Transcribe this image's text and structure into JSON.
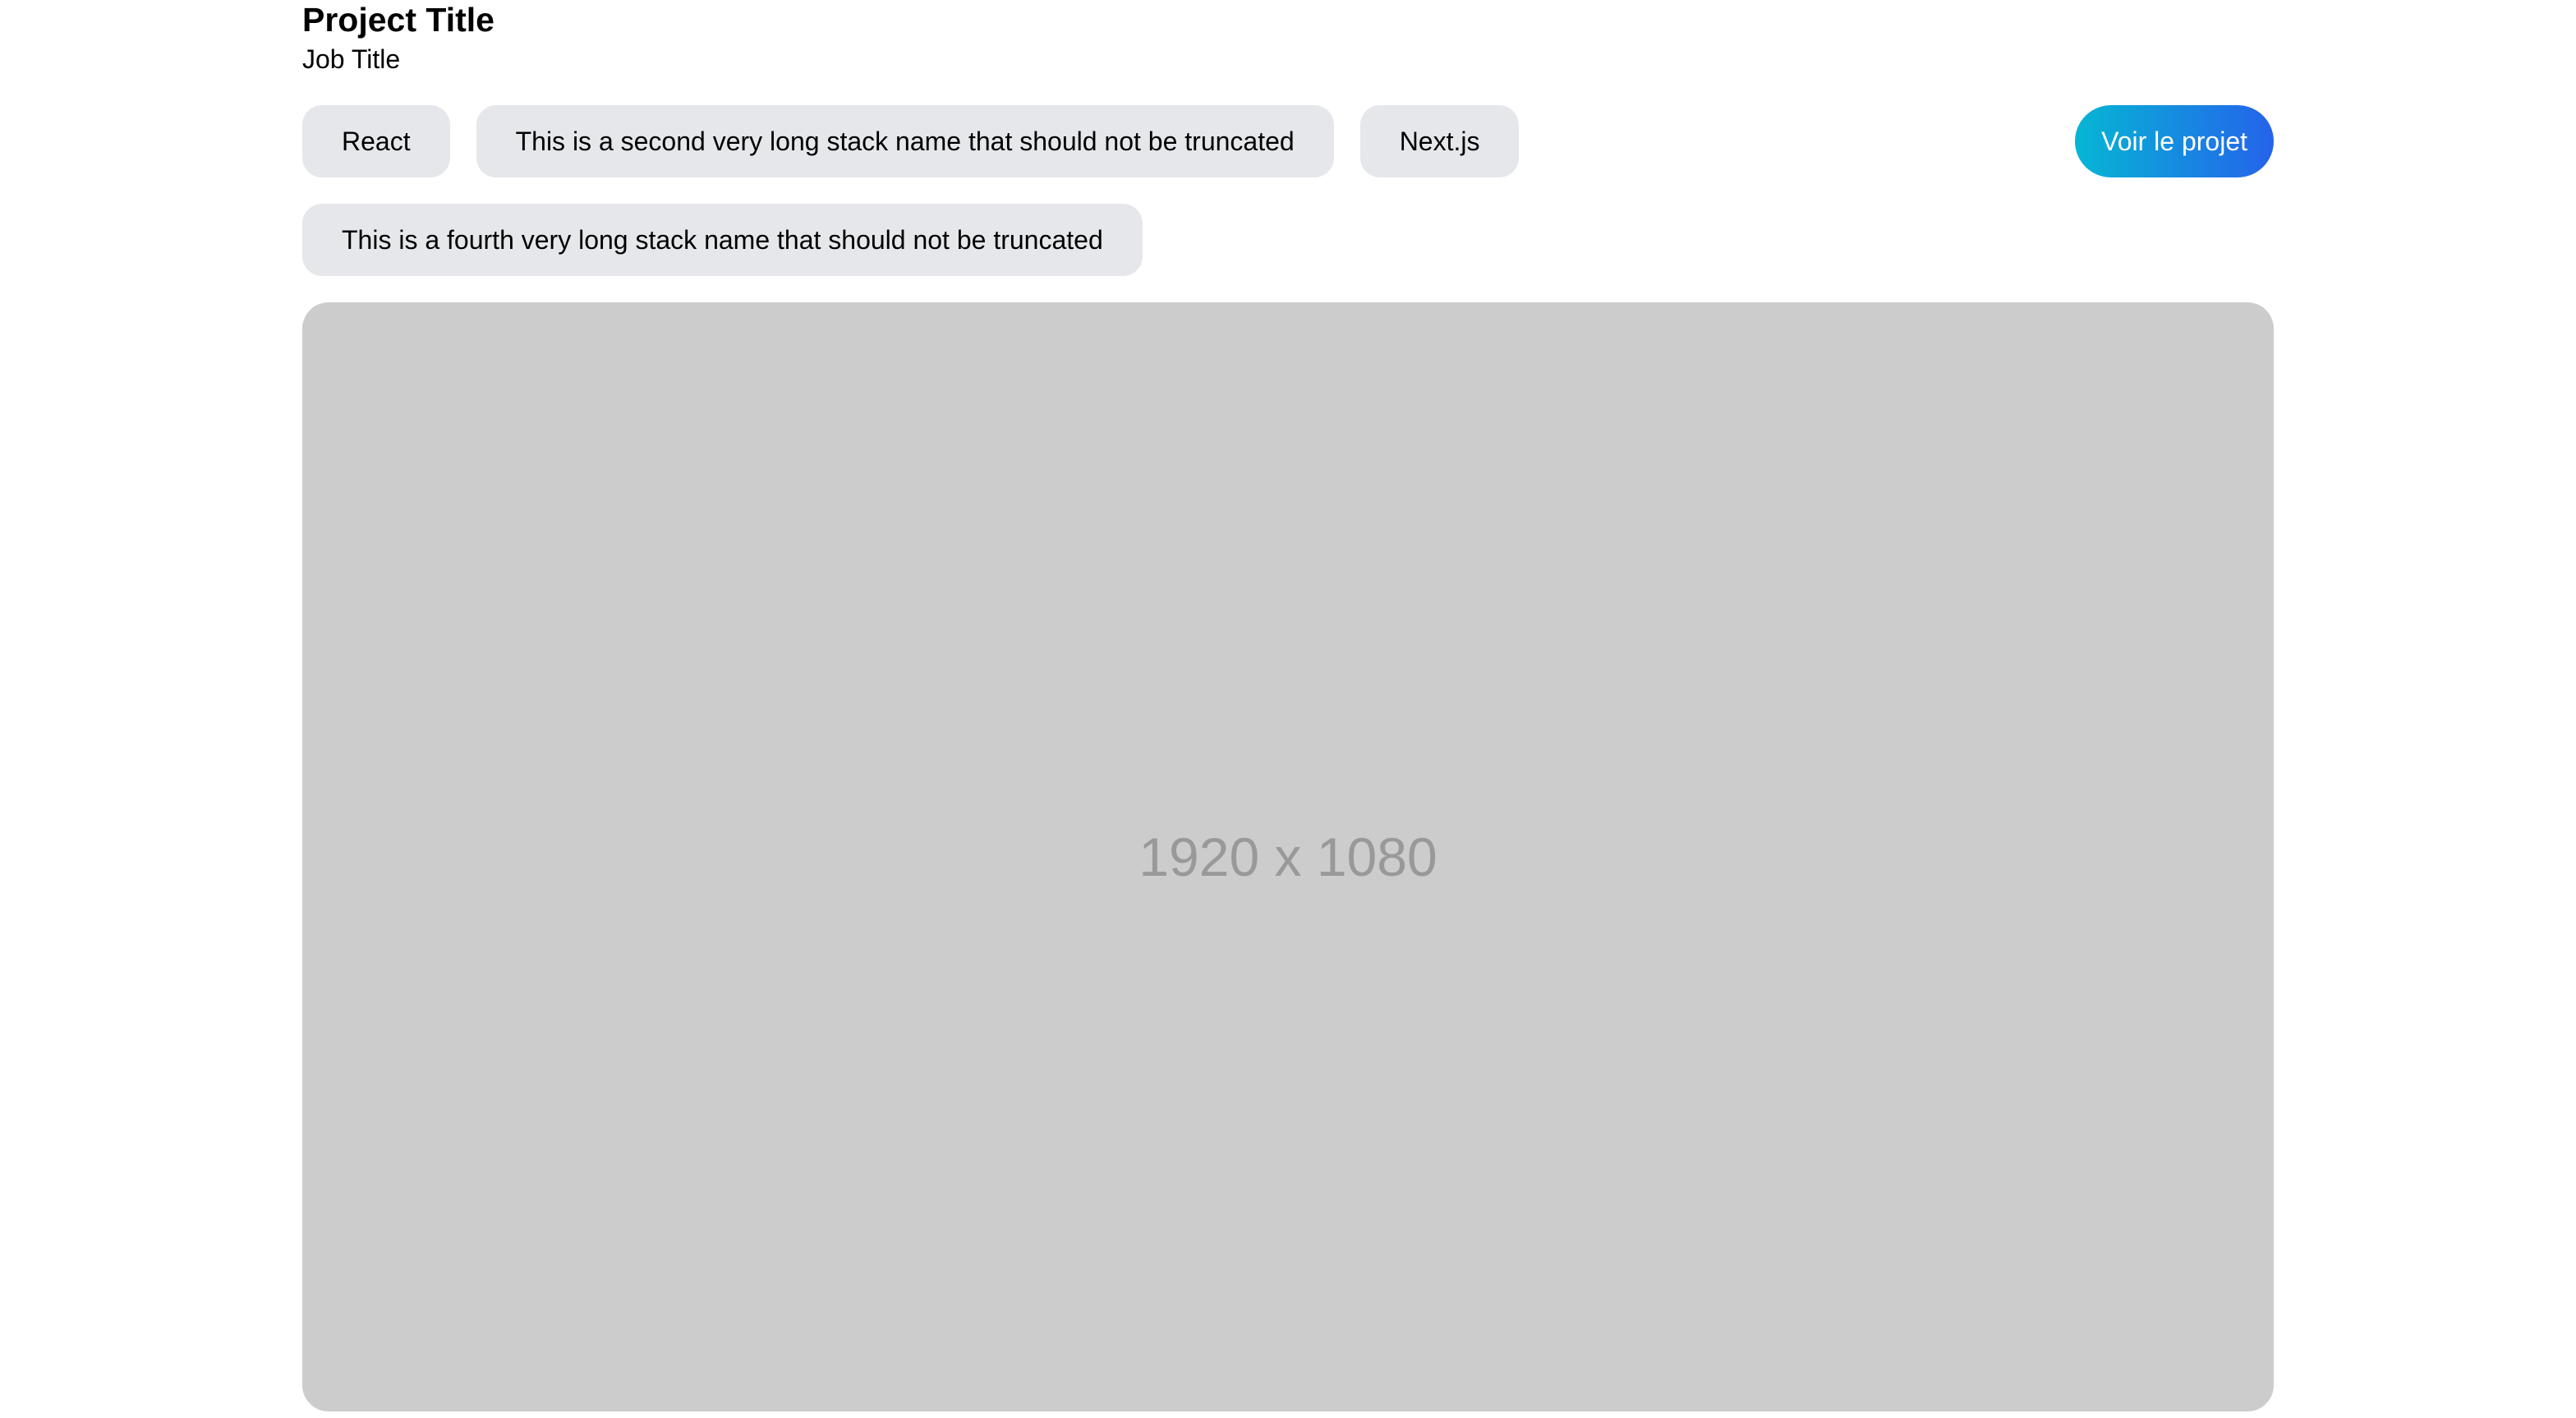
{
  "project": {
    "title": "Project Title",
    "job_title": "Job Title",
    "stacks": [
      "React",
      "This is a second very long stack name that should not be truncated",
      "Next.js",
      "This is a fourth very long stack name that should not be truncated"
    ],
    "cta_label": "Voir le projet",
    "image_placeholder": "1920 x 1080"
  },
  "colors": {
    "chip_bg": "#e5e7eb",
    "button_gradient_start": "#06b6d4",
    "button_gradient_end": "#2563eb",
    "image_bg": "#cccccc"
  }
}
